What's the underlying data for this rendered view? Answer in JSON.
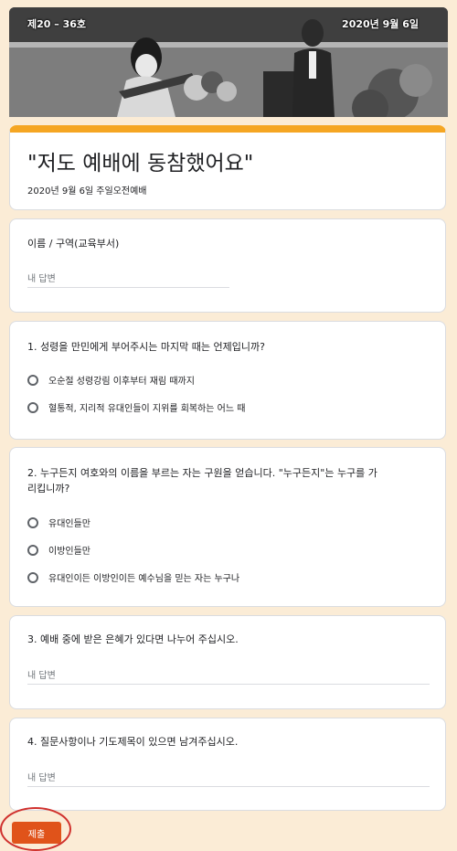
{
  "banner": {
    "left_text": "제20 – 36호",
    "right_text": "2020년 9월 6일"
  },
  "header": {
    "title": "\"저도 예배에 동참했어요\"",
    "description": "2020년 9월 6일 주일오전예배"
  },
  "questions": [
    {
      "title": "이름 / 구역(교육부서)",
      "placeholder": "내 답변"
    },
    {
      "title": "1. 성령을 만민에게 부어주시는 마지막 때는 언제입니까?",
      "options": [
        "오순절 성령강림 이후부터 재림 때까지",
        "혈통적, 지리적 유대인들이 지위를 회복하는 어느 때"
      ]
    },
    {
      "title_line1": "2. 누구든지 여호와의 이름을 부르는 자는 구원을 얻습니다. \"누구든지\"는 누구를 가",
      "title_line2": "리킵니까?",
      "options": [
        "유대인들만",
        "이방인들만",
        "유대인이든 이방인이든 예수님을 믿는 자는 누구나"
      ]
    },
    {
      "title": "3. 예배 중에 받은 은혜가 있다면 나누어 주십시오.",
      "placeholder": "내 답변"
    },
    {
      "title": "4. 질문사항이나 기도제목이 있으면 남겨주십시오.",
      "placeholder": "내 답변"
    }
  ],
  "submit": {
    "label": "제출"
  },
  "colors": {
    "background": "#fbecd6",
    "accent": "#f5a623",
    "submit": "#e0531a",
    "annotation": "#d0312d"
  }
}
